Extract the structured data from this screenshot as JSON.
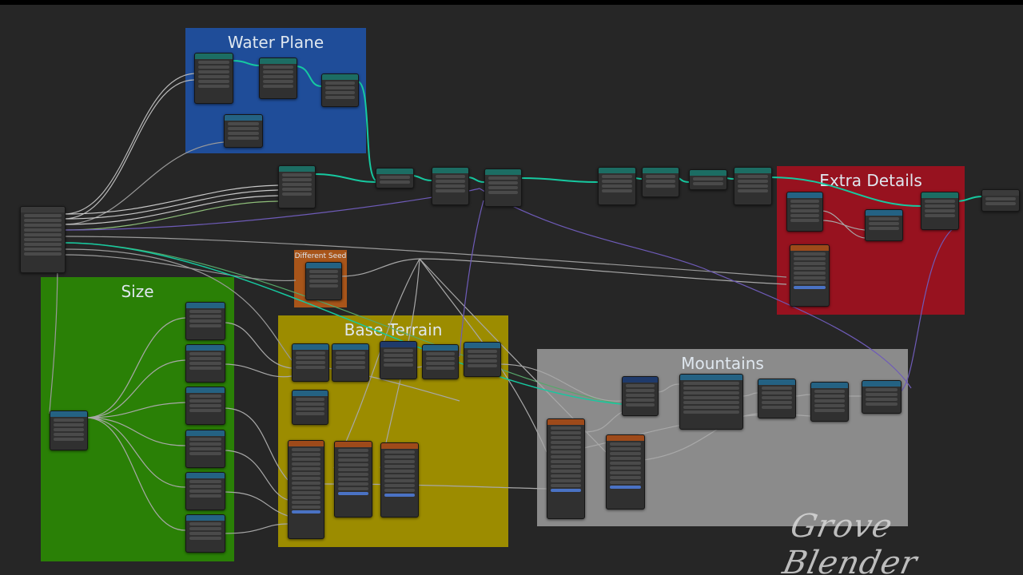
{
  "frames": {
    "water_plane": "Water Plane",
    "extra_details": "Extra Details",
    "size": "Size",
    "different_seed": "Different Seed",
    "base_terrain": "Base Terrain",
    "mountains": "Mountains"
  },
  "watermark": "Grove Blender",
  "colors": {
    "water_plane_frame": "#1f4d99",
    "extra_details_frame": "#97121f",
    "size_frame": "#2a8006",
    "different_seed_frame": "#a8551a",
    "base_terrain_frame": "#9c8c00",
    "mountains_frame": "#8b8b8b",
    "geometry_wire": "#16c9a0",
    "value_wire": "#9a9a9a"
  },
  "icons": {
    "node_collapse": "chevron-down-icon",
    "socket": "socket-dot"
  }
}
